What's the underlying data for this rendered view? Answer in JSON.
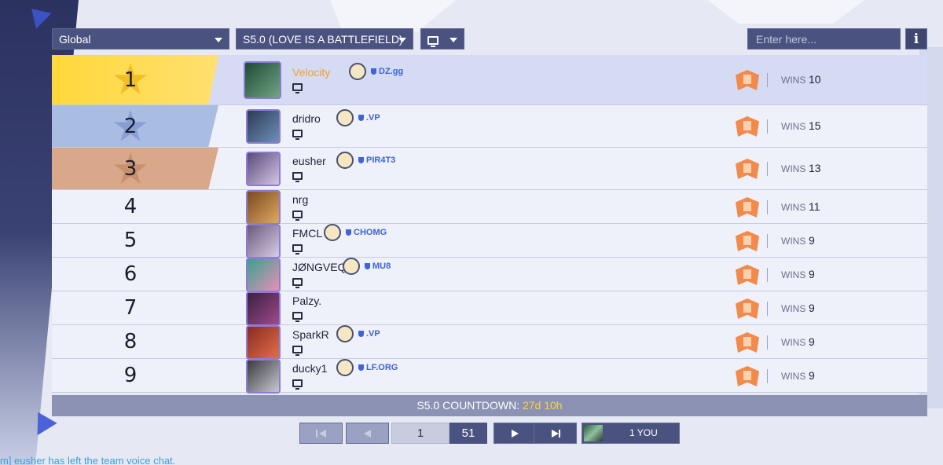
{
  "filters": {
    "region": "Global",
    "season": "S5.0 (LOVE IS A BATTLEFIELD)",
    "platform_icon": "monitor-icon"
  },
  "search": {
    "placeholder": "Enter here..."
  },
  "info_label": "i",
  "columns": {
    "wins_label": "WINS"
  },
  "rows": [
    {
      "rank": "1",
      "name": "Velocity",
      "club": "DZ.gg",
      "wins": "10",
      "avatar_colors": [
        "#1f4a36",
        "#6fa585"
      ]
    },
    {
      "rank": "2",
      "name": "dridro",
      "club": ".VP",
      "wins": "15",
      "avatar_colors": [
        "#2b3b55",
        "#6f90b8"
      ]
    },
    {
      "rank": "3",
      "name": "eusher",
      "club": "PIR4T3",
      "wins": "13",
      "avatar_colors": [
        "#5a4a7a",
        "#d4c6e6"
      ]
    },
    {
      "rank": "4",
      "name": "nrg",
      "club": "",
      "wins": "11",
      "avatar_colors": [
        "#7a4a20",
        "#e0a860"
      ]
    },
    {
      "rank": "5",
      "name": "FMCL",
      "club": "CHOMG",
      "wins": "9",
      "avatar_colors": [
        "#6a5a7a",
        "#d8cce8"
      ]
    },
    {
      "rank": "6",
      "name": "JØNGVEQ",
      "club": "MU8",
      "wins": "9",
      "avatar_colors": [
        "#3aa090",
        "#e890b8"
      ]
    },
    {
      "rank": "7",
      "name": "Palzy.",
      "club": "",
      "wins": "9",
      "avatar_colors": [
        "#3a2040",
        "#a04a8a"
      ]
    },
    {
      "rank": "8",
      "name": "SparkR",
      "club": ".VP",
      "wins": "9",
      "avatar_colors": [
        "#8a2a20",
        "#e0704a"
      ]
    },
    {
      "rank": "9",
      "name": "ducky1",
      "club": "LF.ORG",
      "wins": "9",
      "avatar_colors": [
        "#3a3a40",
        "#c8c8d0"
      ]
    }
  ],
  "countdown": {
    "label": "S5.0  COUNTDOWN:",
    "time": "27d 10h"
  },
  "pagination": {
    "current_page": "1",
    "total_pages": "51",
    "you_label": "1 YOU"
  },
  "chat": {
    "message": "m] eusher has left the team voice chat."
  },
  "colors": {
    "gold": "#ffd83a",
    "silver": "#a9bde3",
    "bronze": "#d9a88a",
    "accent_orange": "#f0a030",
    "club_blue": "#3f63d8",
    "countdown_yellow": "#ffd23f"
  }
}
